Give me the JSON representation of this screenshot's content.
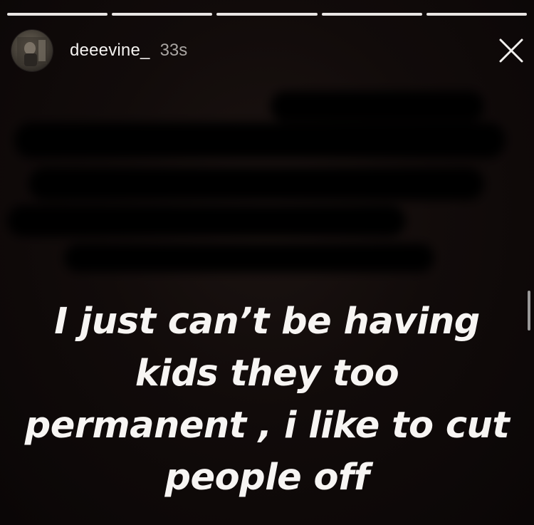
{
  "story": {
    "progress_segments": 5,
    "progress_filled": 5,
    "header": {
      "username": "deeevine_",
      "timestamp": "33s",
      "avatar_icon": "profile-photo",
      "close_icon": "close-icon"
    },
    "caption_lines": [
      "I just can’t be having",
      "kids they too",
      "permanent , i like to cut",
      "people off"
    ]
  },
  "colors": {
    "background": "#0c0807",
    "text": "#f7f5f3",
    "timestamp": "#a9a5a2",
    "progress_fill": "#e9e6e4"
  }
}
